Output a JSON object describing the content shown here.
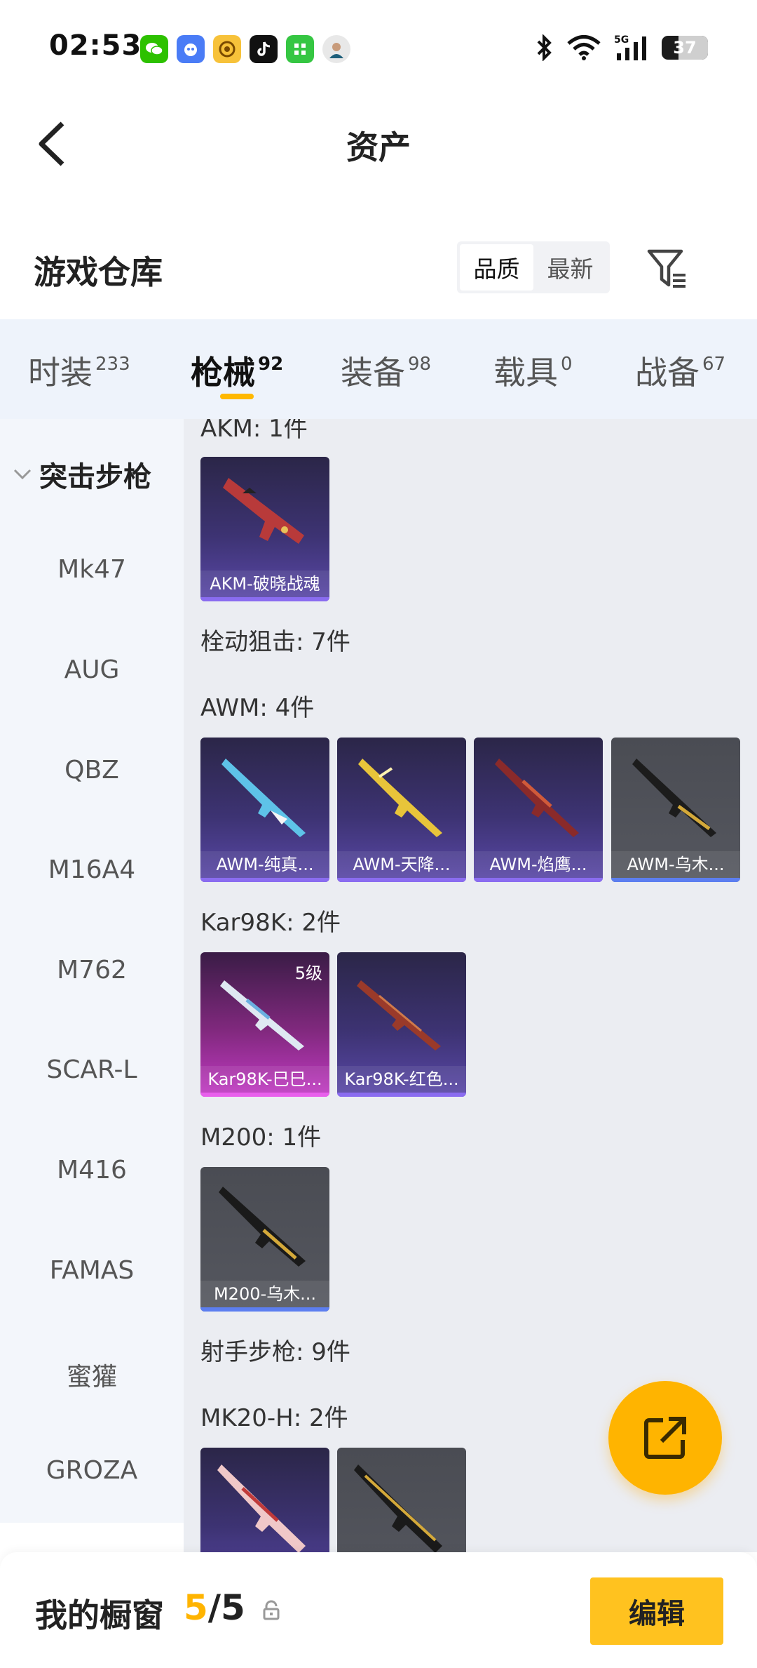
{
  "status_bar": {
    "time": "02:53",
    "battery": "37",
    "battery_level": 0.37,
    "network": "5G",
    "apps": [
      {
        "name": "wechat-app-icon",
        "color": "#2dc100"
      },
      {
        "name": "assistant-app-icon",
        "color": "#4a7cf6"
      },
      {
        "name": "music-app-icon",
        "color": "#f7c23a"
      },
      {
        "name": "tiktok-app-icon",
        "color": "#111111"
      },
      {
        "name": "green-app-icon",
        "color": "#35c642"
      },
      {
        "name": "avatar-app-icon",
        "color": "#e8e8e8"
      }
    ]
  },
  "header": {
    "title": "资产"
  },
  "warehouse": {
    "title": "游戏仓库",
    "sort_options": [
      "品质",
      "最新"
    ],
    "active_sort": "品质"
  },
  "tabs": [
    {
      "label": "时装",
      "count": "233"
    },
    {
      "label": "枪械",
      "count": "92"
    },
    {
      "label": "装备",
      "count": "98"
    },
    {
      "label": "载具",
      "count": "0"
    },
    {
      "label": "战备",
      "count": "67"
    }
  ],
  "active_tab": "枪械",
  "sidebar": {
    "category": "突击步枪",
    "items": [
      "Mk47",
      "AUG",
      "QBZ",
      "M16A4",
      "M762",
      "SCAR-L",
      "M416",
      "FAMAS",
      "蜜獾",
      "GROZA"
    ]
  },
  "content": {
    "sections": [
      {
        "label": "AKM: 1件"
      },
      {
        "label": "栓动狙击: 7件"
      },
      {
        "label": "AWM: 4件"
      },
      {
        "label": "Kar98K: 2件"
      },
      {
        "label": "M200: 1件"
      },
      {
        "label": "射手步枪: 9件"
      },
      {
        "label": "MK20-H: 2件"
      }
    ],
    "cards": [
      {
        "name": "AKM-破晓战魂",
        "rarity": "purple",
        "level": ""
      },
      {
        "name": "AWM-纯真...",
        "rarity": "purple",
        "level": ""
      },
      {
        "name": "AWM-天降...",
        "rarity": "purple",
        "level": ""
      },
      {
        "name": "AWM-焰鹰...",
        "rarity": "purple",
        "level": ""
      },
      {
        "name": "AWM-乌木...",
        "rarity": "gray",
        "level": ""
      },
      {
        "name": "Kar98K-巳巳...",
        "rarity": "pink",
        "level": "5级"
      },
      {
        "name": "Kar98K-红色...",
        "rarity": "purple",
        "level": ""
      },
      {
        "name": "M200-乌木...",
        "rarity": "gray",
        "level": ""
      },
      {
        "name": "",
        "rarity": "purple",
        "level": ""
      },
      {
        "name": "",
        "rarity": "gray",
        "level": ""
      }
    ]
  },
  "bottom": {
    "title": "我的橱窗",
    "current": "5",
    "total": "/5",
    "edit_label": "编辑"
  },
  "colors": {
    "accent": "#ffb400",
    "tab_bg": "#eef3fb",
    "content_bg": "#ebedf2"
  }
}
